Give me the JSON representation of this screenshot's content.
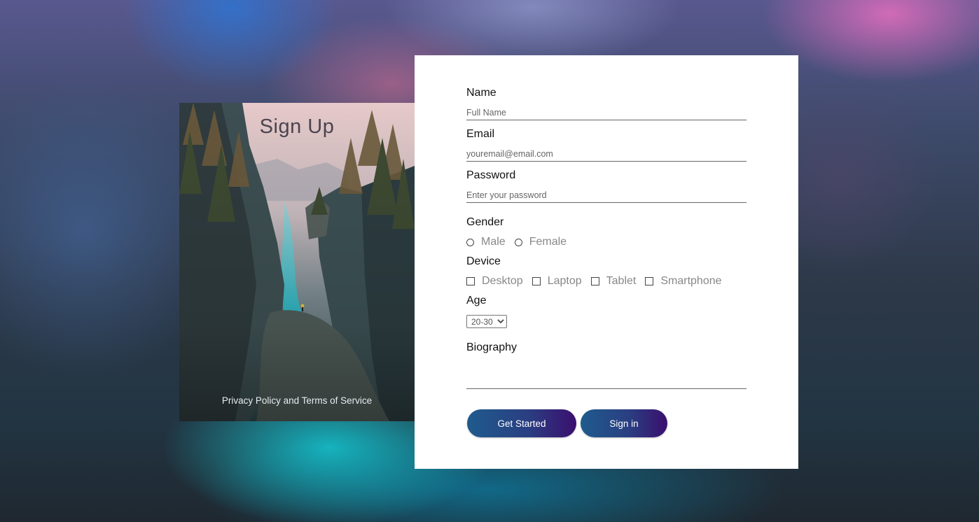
{
  "left_panel": {
    "title": "Sign Up",
    "footer_link": "Privacy Policy and Terms of Service"
  },
  "form": {
    "name": {
      "label": "Name",
      "placeholder": "Full Name",
      "value": ""
    },
    "email": {
      "label": "Email",
      "placeholder": "youremail@email.com",
      "value": ""
    },
    "password": {
      "label": "Password",
      "placeholder": "Enter your password",
      "value": ""
    },
    "gender": {
      "label": "Gender",
      "options": [
        "Male",
        "Female"
      ]
    },
    "device": {
      "label": "Device",
      "options": [
        "Desktop",
        "Laptop",
        "Tablet",
        "Smartphone"
      ]
    },
    "age": {
      "label": "Age",
      "selected": "20-30"
    },
    "biography": {
      "label": "Biography",
      "value": ""
    },
    "buttons": {
      "primary": "Get Started",
      "secondary": "Sign in"
    }
  },
  "colors": {
    "button_gradient_start": "#1f5b8d",
    "button_gradient_end": "#3a0f6e",
    "card_background": "#ffffff"
  }
}
